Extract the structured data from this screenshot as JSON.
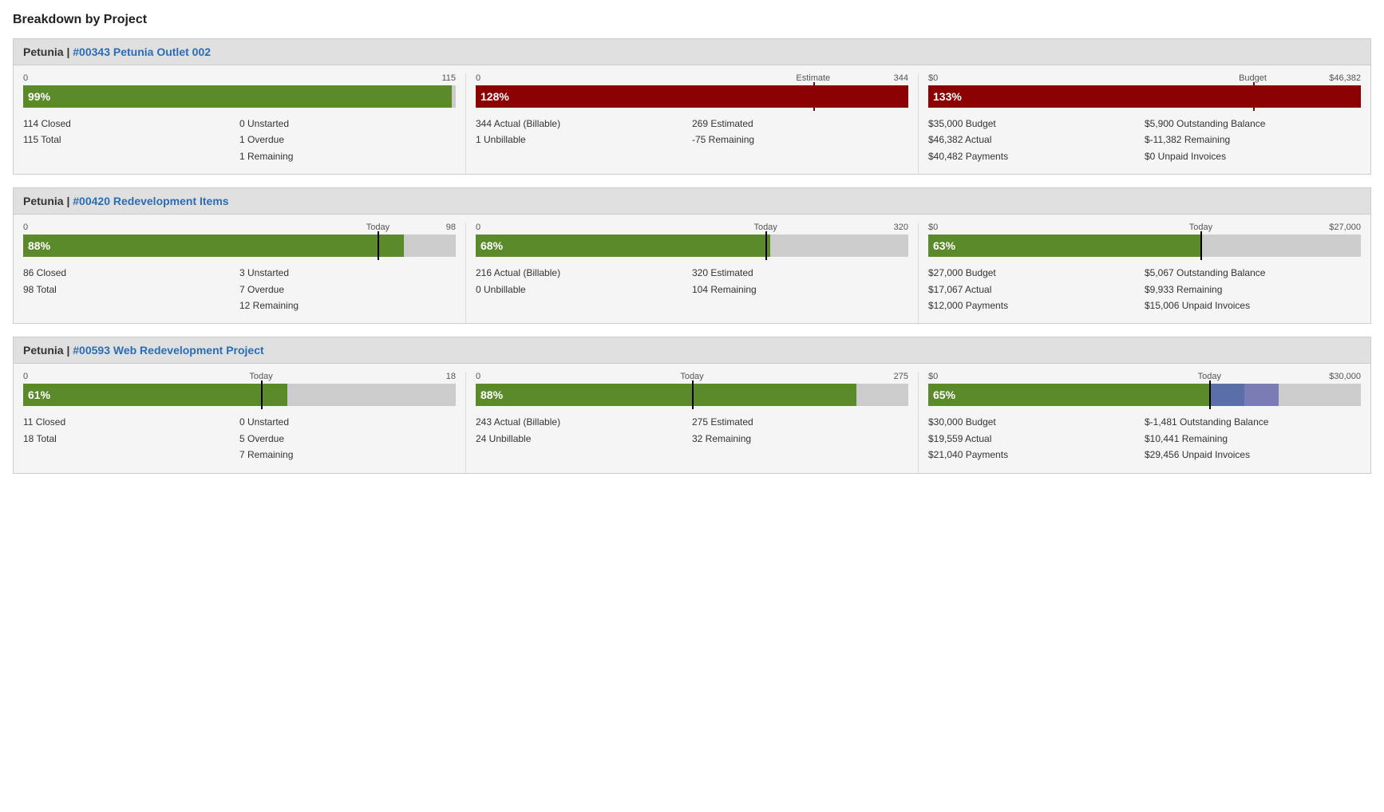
{
  "page": {
    "title": "Breakdown by Project"
  },
  "projects": [
    {
      "id": "project-1",
      "client": "Petunia",
      "project_name": "#00343 Petunia Outlet 002",
      "tasks": {
        "bar_min": "0",
        "bar_max": "115",
        "bar_marker_label": null,
        "bar_pct": 99,
        "bar_pct_label": "99%",
        "bar_color": "green",
        "bar_marker_pct": null,
        "has_today_marker": false,
        "stats_left": [
          "114 Closed",
          "115 Total"
        ],
        "stats_right": [
          "0 Unstarted",
          "1 Overdue",
          "1 Remaining"
        ]
      },
      "hours": {
        "bar_min": "0",
        "bar_max": "344",
        "bar_marker_label": "Estimate",
        "bar_pct": 128,
        "bar_pct_label": "128%",
        "bar_color": "dark-red",
        "bar_marker_pct": 78,
        "has_today_marker": false,
        "stats_left": [
          "344 Actual (Billable)",
          "1 Unbillable"
        ],
        "stats_right": [
          "269 Estimated",
          "-75 Remaining"
        ]
      },
      "budget": {
        "bar_min": "$0",
        "bar_max": "$46,382",
        "bar_marker_label": "Budget",
        "bar_pct": 133,
        "bar_pct_label": "133%",
        "bar_color": "dark-red",
        "bar_marker_pct": 75,
        "has_today_marker": false,
        "stats_left": [
          "$35,000 Budget",
          "$46,382 Actual",
          "$40,482 Payments"
        ],
        "stats_right": [
          "$5,900 Outstanding Balance",
          "$-11,382 Remaining",
          "$0 Unpaid Invoices"
        ]
      }
    },
    {
      "id": "project-2",
      "client": "Petunia",
      "project_name": "#00420 Redevelopment Items",
      "tasks": {
        "bar_min": "0",
        "bar_max": "98",
        "bar_marker_label": "Today",
        "bar_pct": 88,
        "bar_pct_label": "88%",
        "bar_color": "green",
        "bar_marker_pct": 82,
        "has_today_marker": true,
        "stats_left": [
          "86 Closed",
          "98 Total"
        ],
        "stats_right": [
          "3 Unstarted",
          "7 Overdue",
          "12 Remaining"
        ]
      },
      "hours": {
        "bar_min": "0",
        "bar_max": "320",
        "bar_marker_label": "Today",
        "bar_pct": 68,
        "bar_pct_label": "68%",
        "bar_color": "green",
        "bar_marker_pct": 67,
        "has_today_marker": true,
        "stats_left": [
          "216 Actual (Billable)",
          "0 Unbillable"
        ],
        "stats_right": [
          "320 Estimated",
          "104 Remaining"
        ]
      },
      "budget": {
        "bar_min": "$0",
        "bar_max": "$27,000",
        "bar_marker_label": "Today",
        "bar_pct": 63,
        "bar_pct_label": "63%",
        "bar_color": "green",
        "bar_marker_pct": 63,
        "has_today_marker": true,
        "stats_left": [
          "$27,000 Budget",
          "$17,067 Actual",
          "$12,000 Payments"
        ],
        "stats_right": [
          "$5,067 Outstanding Balance",
          "$9,933 Remaining",
          "$15,006 Unpaid Invoices"
        ]
      }
    },
    {
      "id": "project-3",
      "client": "Petunia",
      "project_name": "#00593 Web Redevelopment Project",
      "tasks": {
        "bar_min": "0",
        "bar_max": "18",
        "bar_marker_label": "Today",
        "bar_pct": 61,
        "bar_pct_label": "61%",
        "bar_color": "green",
        "bar_marker_pct": 55,
        "has_today_marker": true,
        "stats_left": [
          "11 Closed",
          "18 Total"
        ],
        "stats_right": [
          "0 Unstarted",
          "5 Overdue",
          "7 Remaining"
        ]
      },
      "hours": {
        "bar_min": "0",
        "bar_max": "275",
        "bar_marker_label": "Today",
        "bar_pct": 88,
        "bar_pct_label": "88%",
        "bar_color": "green",
        "bar_marker_pct": 50,
        "has_today_marker": true,
        "stats_left": [
          "243 Actual (Billable)",
          "24 Unbillable"
        ],
        "stats_right": [
          "275 Estimated",
          "32 Remaining"
        ]
      },
      "budget": {
        "bar_min": "$0",
        "bar_max": "$30,000",
        "bar_marker_label": "Today",
        "bar_pct": 65,
        "bar_pct_label": "65%",
        "bar_color": "green",
        "bar_marker_pct": 65,
        "has_today_marker": true,
        "has_extra_segments": true,
        "stats_left": [
          "$30,000 Budget",
          "$19,559 Actual",
          "$21,040 Payments"
        ],
        "stats_right": [
          "$-1,481 Outstanding Balance",
          "$10,441 Remaining",
          "$29,456 Unpaid Invoices"
        ]
      }
    }
  ]
}
